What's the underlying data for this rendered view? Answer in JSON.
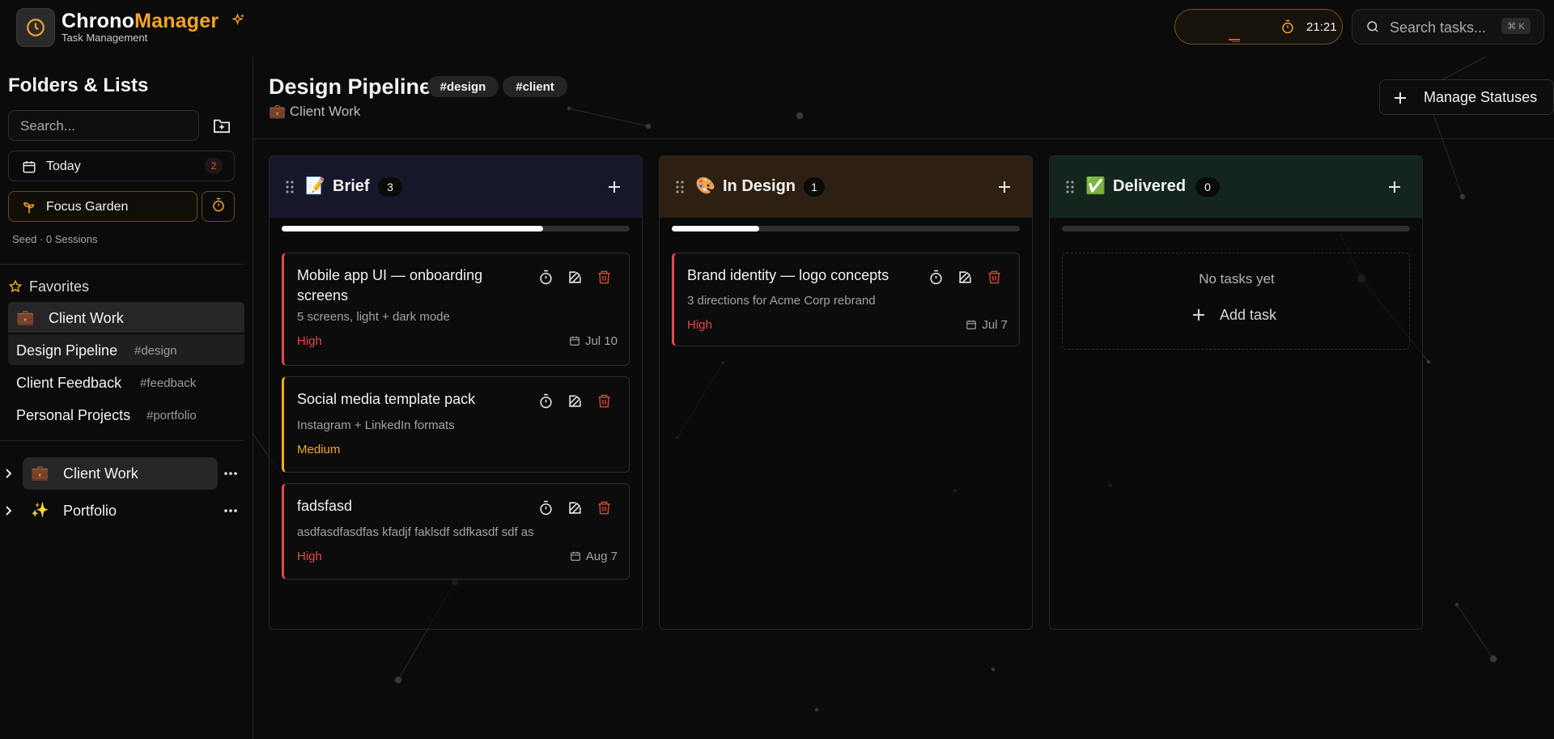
{
  "app": {
    "name_part1": "Chrono",
    "name_part2": "Manager",
    "subtitle": "Task Management",
    "timer": "21:21",
    "search_placeholder": "Search tasks...",
    "search_shortcut": "⌘ K"
  },
  "sidebar": {
    "title": "Folders & Lists",
    "search_placeholder": "Search...",
    "today": {
      "label": "Today",
      "count": "2"
    },
    "focus": {
      "label": "Focus Garden",
      "stats": "Seed · 0 Sessions"
    },
    "favorites_title": "Favorites",
    "favorites": [
      {
        "emoji": "💼",
        "label": "Client Work",
        "tag": ""
      },
      {
        "emoji": "",
        "label": "Design Pipeline",
        "tag": "#design"
      },
      {
        "emoji": "",
        "label": "Client Feedback",
        "tag": "#feedback"
      },
      {
        "emoji": "",
        "label": "Personal Projects",
        "tag": "#portfolio"
      }
    ],
    "folders": [
      {
        "emoji": "💼",
        "label": "Client Work"
      },
      {
        "emoji": "✨",
        "label": "Portfolio"
      }
    ]
  },
  "page": {
    "title": "Design Pipeline",
    "tags": [
      "#design",
      "#client"
    ],
    "breadcrumb": "💼 Client Work",
    "manage_button": "Manage Statuses"
  },
  "columns": [
    {
      "emoji": "📝",
      "name": "Brief",
      "count": "3",
      "progress": 0.75,
      "header_color": "#17172b",
      "cards": [
        {
          "title": "Mobile app UI — onboarding screens",
          "desc": "5 screens, light + dark mode",
          "priority": "High",
          "due": "Jul 10"
        },
        {
          "title": "Social media template pack",
          "desc": "Instagram + LinkedIn formats",
          "priority": "Medium",
          "due": ""
        },
        {
          "title": "fadsfasd",
          "desc": "asdfasdfasdfas kfadjf faklsdf sdfkasdf sdf as",
          "priority": "High",
          "due": "Aug 7"
        }
      ]
    },
    {
      "emoji": "🎨",
      "name": "In Design",
      "count": "1",
      "progress": 0.25,
      "header_color": "#2d2012",
      "cards": [
        {
          "title": "Brand identity — logo concepts",
          "desc": "3 directions for Acme Corp rebrand",
          "priority": "High",
          "due": "Jul 7"
        }
      ]
    },
    {
      "emoji": "✅",
      "name": "Delivered",
      "count": "0",
      "progress": 0,
      "header_color": "#13251d",
      "cards": [],
      "empty_text": "No tasks yet",
      "add_text": "Add task"
    }
  ],
  "colors": {
    "accent": "#f5a524",
    "priority_high": "#e5484d",
    "priority_medium": "#f5a524",
    "delete": "#c2472f"
  }
}
